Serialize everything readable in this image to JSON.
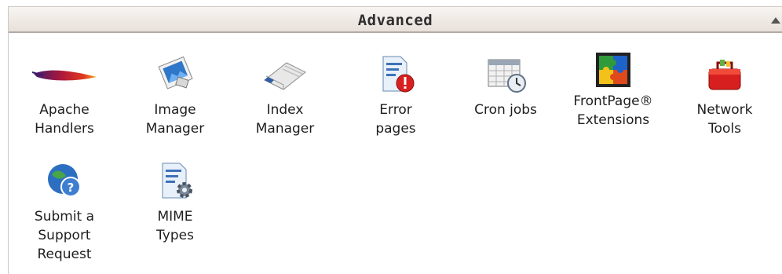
{
  "panel": {
    "title": "Advanced",
    "toggle_icon": "collapse-up-arrow-icon"
  },
  "items": [
    {
      "label": "Apache\nHandlers",
      "icon": "apache-feather-icon"
    },
    {
      "label": "Image\nManager",
      "icon": "image-manager-icon"
    },
    {
      "label": "Index\nManager",
      "icon": "open-book-icon"
    },
    {
      "label": "Error\npages",
      "icon": "error-page-icon"
    },
    {
      "label": "Cron jobs",
      "icon": "calendar-clock-icon"
    },
    {
      "label": "FrontPage®\nExtensions",
      "icon": "frontpage-puzzle-icon"
    },
    {
      "label": "Network\nTools",
      "icon": "red-toolbox-icon"
    },
    {
      "label": "Submit a\nSupport\nRequest",
      "icon": "support-globe-icon"
    },
    {
      "label": "MIME\nTypes",
      "icon": "mime-document-gear-icon"
    }
  ]
}
